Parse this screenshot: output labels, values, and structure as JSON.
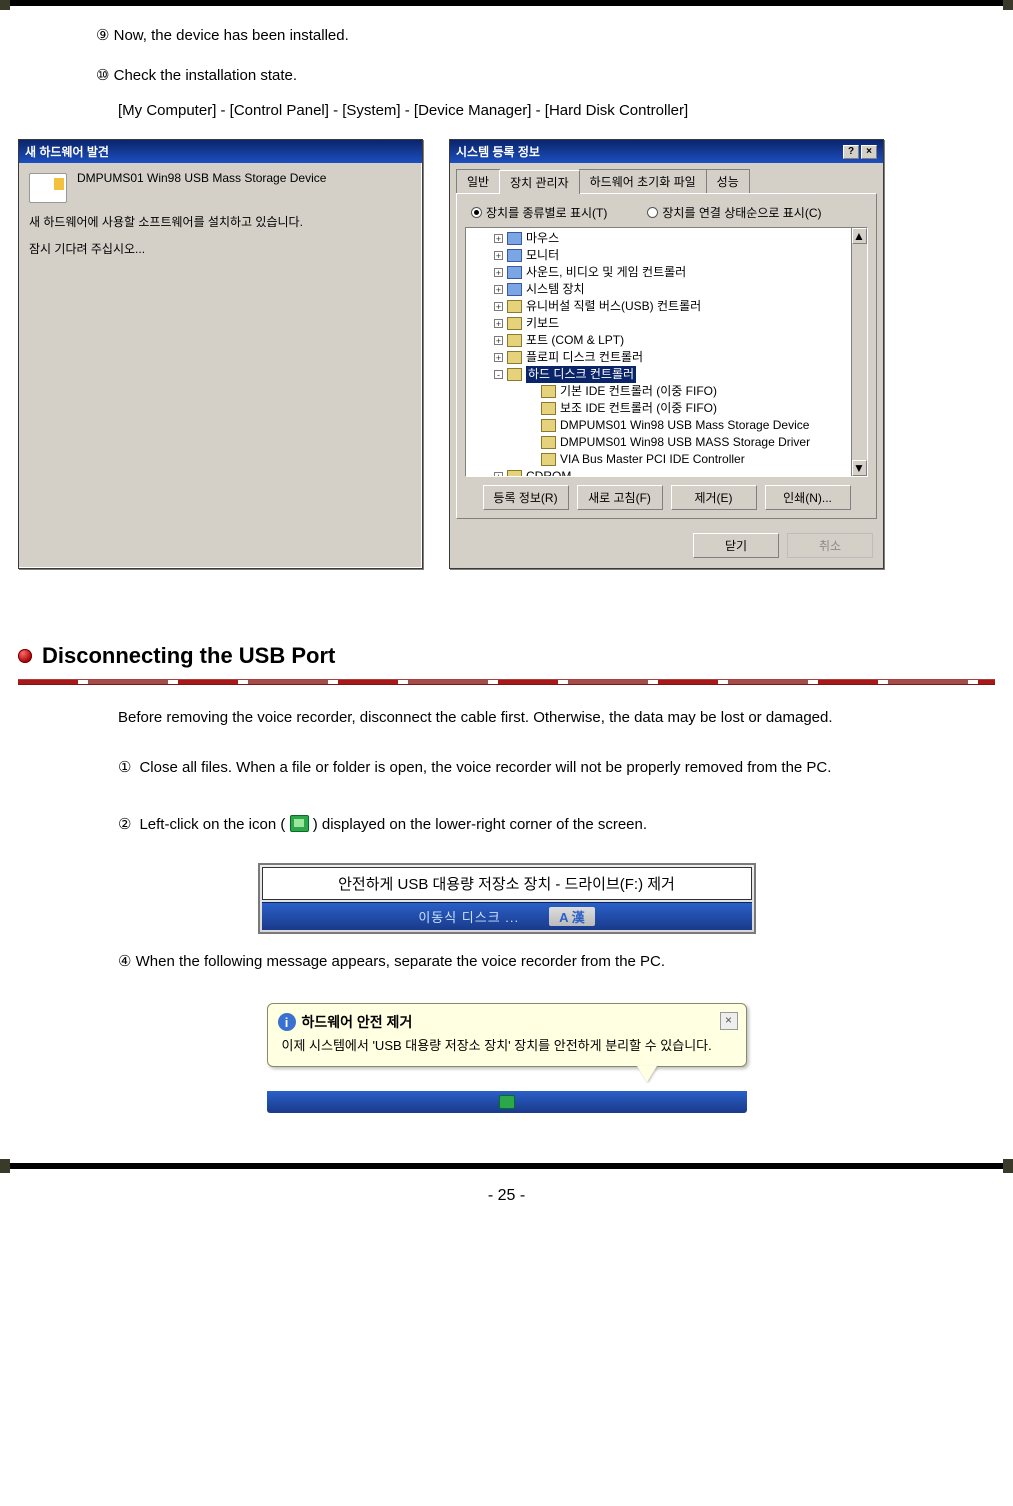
{
  "steps_top": {
    "s9": "⑨ Now, the device has been installed.",
    "s10": "⑩ Check the installation state.",
    "path": "[My Computer] - [Control Panel] - [System] - [Device Manager] - [Hard Disk Controller]"
  },
  "dlg_small": {
    "title": "새 하드웨어 발견",
    "device": "DMPUMS01 Win98 USB Mass Storage Device",
    "line1": "새 하드웨어에 사용할 소프트웨어를 설치하고 있습니다.",
    "line2": "잠시 기다려 주십시오..."
  },
  "dlg_big": {
    "title": "시스템 등록 정보",
    "tabs": {
      "t1": "일반",
      "t2": "장치 관리자",
      "t3": "하드웨어 초기화 파일",
      "t4": "성능"
    },
    "radios": {
      "r1": "장치를 종류별로 표시(T)",
      "r2": "장치를 연결 상태순으로 표시(C)"
    },
    "tree": [
      {
        "lvl": 1,
        "pm": "+",
        "icon": "alt",
        "label": "마우스"
      },
      {
        "lvl": 1,
        "pm": "+",
        "icon": "alt",
        "label": "모니터"
      },
      {
        "lvl": 1,
        "pm": "+",
        "icon": "alt",
        "label": "사운드, 비디오 및 게임 컨트롤러"
      },
      {
        "lvl": 1,
        "pm": "+",
        "icon": "alt",
        "label": "시스템 장치"
      },
      {
        "lvl": 1,
        "pm": "+",
        "icon": "",
        "label": "유니버설 직렬 버스(USB) 컨트롤러"
      },
      {
        "lvl": 1,
        "pm": "+",
        "icon": "",
        "label": "키보드"
      },
      {
        "lvl": 1,
        "pm": "+",
        "icon": "",
        "label": "포트 (COM & LPT)"
      },
      {
        "lvl": 1,
        "pm": "+",
        "icon": "",
        "label": "플로피 디스크 컨트롤러"
      },
      {
        "lvl": 1,
        "pm": "-",
        "icon": "",
        "label": "하드 디스크 컨트롤러",
        "sel": true
      },
      {
        "lvl": 2,
        "pm": "",
        "icon": "",
        "label": "기본 IDE 컨트롤러 (이중 FIFO)"
      },
      {
        "lvl": 2,
        "pm": "",
        "icon": "",
        "label": "보조 IDE 컨트롤러 (이중 FIFO)"
      },
      {
        "lvl": 2,
        "pm": "",
        "icon": "",
        "label": "DMPUMS01 Win98 USB Mass Storage Device"
      },
      {
        "lvl": 2,
        "pm": "",
        "icon": "",
        "label": "DMPUMS01 Win98 USB MASS Storage Driver"
      },
      {
        "lvl": 2,
        "pm": "",
        "icon": "",
        "label": "VIA Bus Master PCI IDE Controller"
      },
      {
        "lvl": 1,
        "pm": "+",
        "icon": "",
        "label": "CDROM"
      }
    ],
    "buttons": {
      "b1": "등록 정보(R)",
      "b2": "새로 고침(F)",
      "b3": "제거(E)",
      "b4": "인쇄(N)..."
    },
    "footer": {
      "ok": "닫기",
      "cancel": "취소"
    },
    "help_glyph": "?",
    "close_glyph": "×"
  },
  "section": {
    "title": "Disconnecting the USB Port"
  },
  "disc_intro": "Before removing the voice recorder, disconnect the cable first.    Otherwise, the data may be lost or damaged.",
  "disc_steps": {
    "n1": "①",
    "t1a": "Close all files.   When a file or folder is open, the voice recorder will not be properly removed from the PC.",
    "n2": "②",
    "t2a": "Left-click on the icon (",
    "t2b": ") displayed on the lower-right corner of the screen.",
    "n4": "④ When the following message appears, separate the voice recorder from the PC."
  },
  "tooltip": {
    "text": "안전하게 USB 대용량 저장소 장치 - 드라이브(F:) 제거",
    "task1": "이동식 디스크 ...",
    "task2": "A 漢"
  },
  "balloon": {
    "title": "하드웨어 안전 제거",
    "msg": "이제 시스템에서 'USB 대용량 저장소 장치' 장치를 안전하게 분리할 수 있습니다.",
    "info_glyph": "i",
    "close_glyph": "×"
  },
  "page_number": "- 25 -"
}
